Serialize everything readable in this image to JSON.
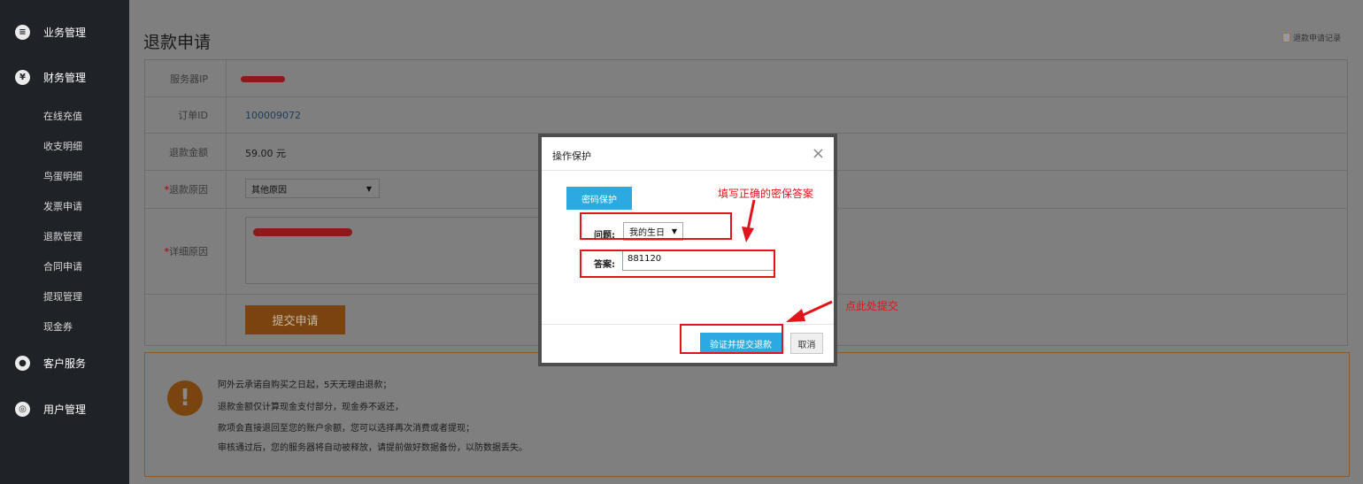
{
  "sidebar": {
    "groups": [
      {
        "label": "业务管理",
        "icon": "list-icon"
      },
      {
        "label": "财务管理",
        "icon": "yen-icon"
      },
      {
        "label": "客户服务",
        "icon": "user-icon"
      },
      {
        "label": "用户管理",
        "icon": "users-icon"
      }
    ],
    "finance_items": [
      "在线充值",
      "收支明细",
      "鸟蛋明细",
      "发票申请",
      "退款管理",
      "合同申请",
      "提现管理",
      "现金券"
    ]
  },
  "page": {
    "title": "退款申请",
    "history_link": "退款申请记录"
  },
  "form": {
    "server_ip_label": "服务器IP",
    "order_id_label": "订单ID",
    "order_id_value": "100009072",
    "amount_label": "退款金额",
    "amount_value": "59.00 元",
    "reason_label": "退款原因",
    "reason_required_mark": "*",
    "reason_value": "其他原因",
    "detail_label": "详细原因",
    "detail_required_mark": "*",
    "submit_label": "提交申请"
  },
  "notice": {
    "lines": [
      "阿外云承诺自购买之日起，5天无理由退款；",
      "退款金额仅计算现金支付部分，现金券不返还，",
      "款项会直接退回至您的账户余额，您可以选择再次消费或者提现；",
      "审核通过后，您的服务器将自动被释放，请提前做好数据备份，以防数据丢失。"
    ]
  },
  "modal": {
    "title": "操作保护",
    "close_symbol": "×",
    "tab_label": "密码保护",
    "question_label": "问题:",
    "question_value": "我的生日",
    "answer_label": "答案:",
    "answer_value": "881120",
    "verify_label": "验证并提交退款",
    "cancel_label": "取消"
  },
  "annotations": {
    "fill_answer": "填写正确的密保答案",
    "click_submit": "点此处提交",
    "color": "#e0141a"
  },
  "colors": {
    "sidebar_bg": "#1f2328",
    "accent_blue": "#2aaae0",
    "accent_orange": "#e8820c"
  }
}
